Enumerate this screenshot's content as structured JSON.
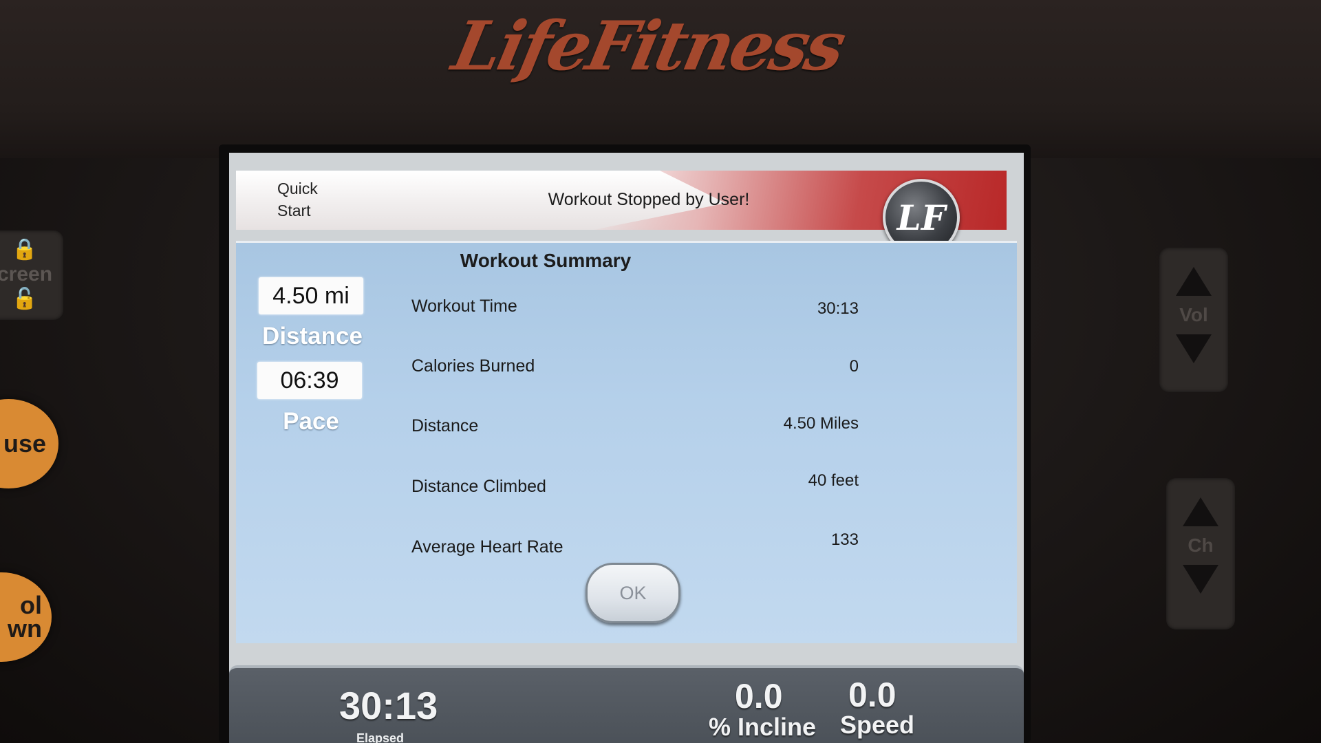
{
  "brand": "LifeFitness",
  "header": {
    "quick_start": [
      "Quick",
      "Start"
    ],
    "message": "Workout Stopped by User!",
    "logo_text": "LF"
  },
  "summary": {
    "title": "Workout Summary",
    "rows": [
      {
        "label": "Workout Time",
        "value": "30:13"
      },
      {
        "label": "Calories Burned",
        "value": "0"
      },
      {
        "label": "Distance",
        "value": "4.50 Miles"
      },
      {
        "label": "Distance Climbed",
        "value": "40 feet"
      },
      {
        "label": "Average Heart Rate",
        "value": "133"
      }
    ],
    "ok_label": "OK"
  },
  "side_metrics": {
    "distance_value": "4.50 mi",
    "distance_label": "Distance",
    "pace_value": "06:39",
    "pace_label": "Pace"
  },
  "status_bar": {
    "elapsed_value": "30:13",
    "elapsed_label": "Elapsed",
    "incline_value": "0.0",
    "incline_label": "% Incline",
    "speed_value": "0.0",
    "speed_label": "Speed"
  },
  "hardware": {
    "lock_label": "creen",
    "pause_label": "use",
    "cool_down_label": [
      "ol",
      "wn"
    ],
    "vol_label": "Vol",
    "ch_label": "Ch"
  },
  "colors": {
    "brand_orange": "#d98a33",
    "header_red": "#b62222",
    "panel_blue": "#b5d0ea"
  }
}
